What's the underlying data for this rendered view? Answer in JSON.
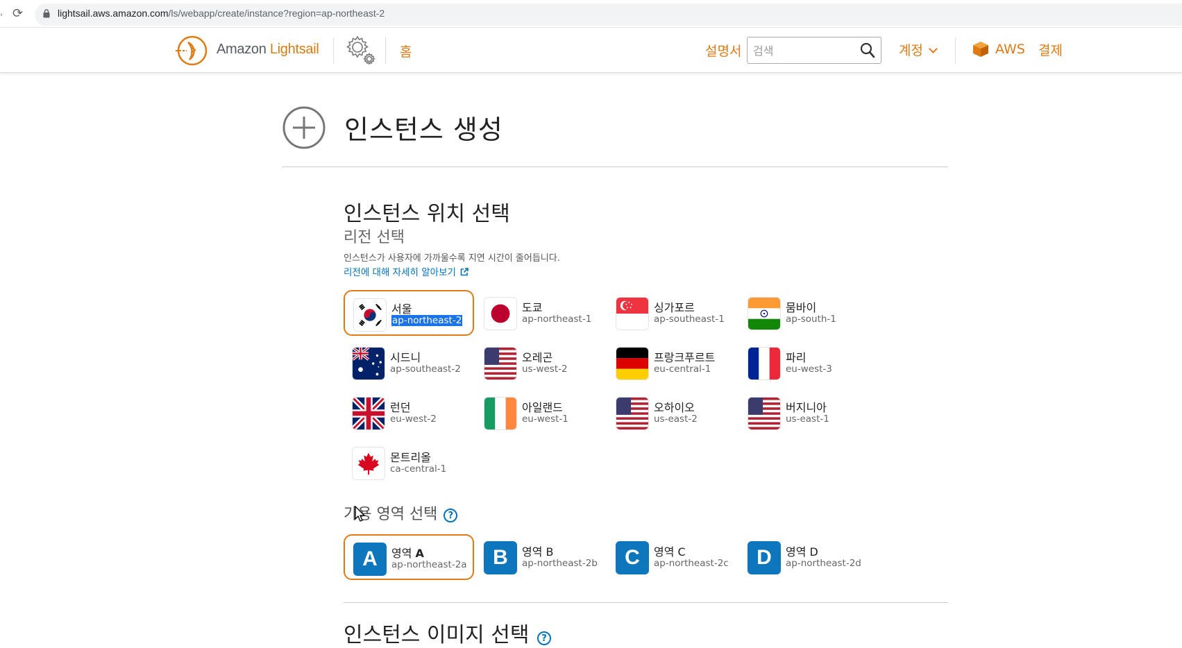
{
  "browser": {
    "url_host": "lightsail.aws.amazon.com",
    "url_path": "/ls/webapp/create/instance?region=ap-northeast-2"
  },
  "header": {
    "logo_prefix": "Amazon ",
    "logo_brand": "Lightsail",
    "home": "홈",
    "docs": "설명서",
    "search_placeholder": "검색",
    "account": "계정",
    "aws": "AWS",
    "billing": "결제"
  },
  "page": {
    "title": "인스턴스 생성",
    "location_title": "인스턴스 위치 선택",
    "region_title": "리전 선택",
    "region_desc": "인스턴스가 사용자에 가까울수록 지연 시간이 줄어듭니다.",
    "learn_more": "리전에 대해 자세히 알아보기",
    "az_title": "가용 영역 선택",
    "help_glyph": "?",
    "image_title": "인스턴스 이미지 선택"
  },
  "regions": [
    {
      "name": "서울",
      "code": "ap-northeast-2",
      "flag": "korea-flag-icon",
      "selected": true
    },
    {
      "name": "도쿄",
      "code": "ap-northeast-1",
      "flag": "japan-flag-icon"
    },
    {
      "name": "싱가포르",
      "code": "ap-southeast-1",
      "flag": "singapore-flag-icon"
    },
    {
      "name": "뭄바이",
      "code": "ap-south-1",
      "flag": "india-flag-icon"
    },
    {
      "name": "시드니",
      "code": "ap-southeast-2",
      "flag": "australia-flag-icon"
    },
    {
      "name": "오레곤",
      "code": "us-west-2",
      "flag": "usa-flag-icon"
    },
    {
      "name": "프랑크푸르트",
      "code": "eu-central-1",
      "flag": "germany-flag-icon"
    },
    {
      "name": "파리",
      "code": "eu-west-3",
      "flag": "france-flag-icon"
    },
    {
      "name": "런던",
      "code": "eu-west-2",
      "flag": "uk-flag-icon"
    },
    {
      "name": "아일랜드",
      "code": "eu-west-1",
      "flag": "ireland-flag-icon"
    },
    {
      "name": "오하이오",
      "code": "us-east-2",
      "flag": "usa-flag-icon"
    },
    {
      "name": "버지니아",
      "code": "us-east-1",
      "flag": "usa-flag-icon"
    },
    {
      "name": "몬트리올",
      "code": "ca-central-1",
      "flag": "canada-flag-icon"
    }
  ],
  "zones": [
    {
      "letter": "A",
      "label": "영역 ",
      "label_letter": "A",
      "code": "ap-northeast-2a",
      "selected": true
    },
    {
      "letter": "B",
      "label": "영역 ",
      "label_letter": "B",
      "code": "ap-northeast-2b"
    },
    {
      "letter": "C",
      "label": "영역 ",
      "label_letter": "C",
      "code": "ap-northeast-2c"
    },
    {
      "letter": "D",
      "label": "영역 ",
      "label_letter": "D",
      "code": "ap-northeast-2d"
    }
  ],
  "colors": {
    "accent": "#e07b13",
    "link": "#0073bb",
    "zone_badge": "#0e76bc",
    "text_highlight": "#1a73e8"
  }
}
